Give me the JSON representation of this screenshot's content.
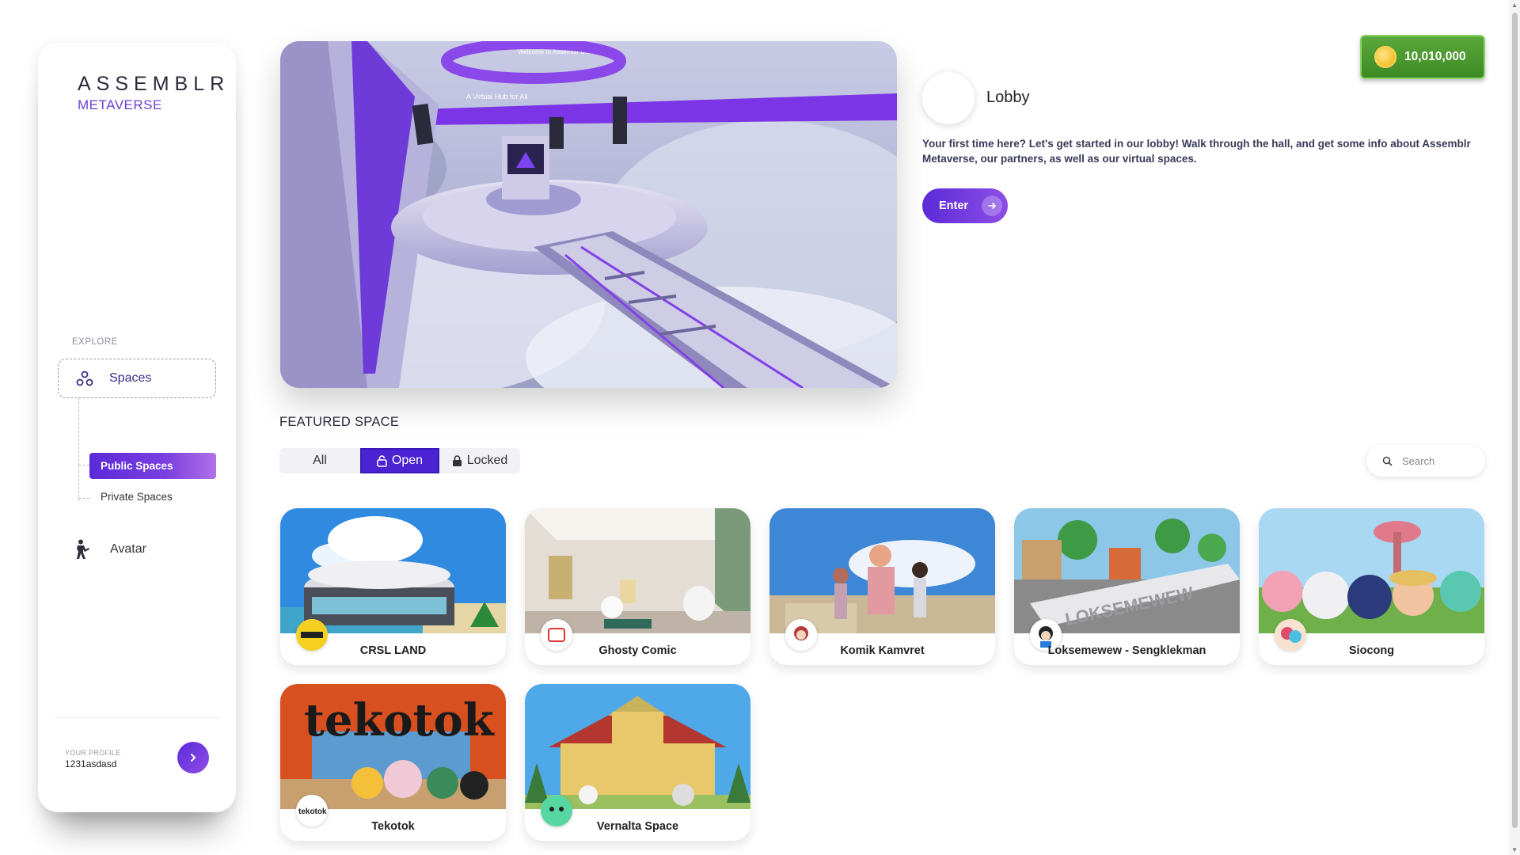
{
  "brand": {
    "name": "ASSEMBLR",
    "sub": "METAVERSE"
  },
  "sidebar": {
    "section_label": "EXPLORE",
    "spaces_label": "Spaces",
    "public_spaces_label": "Public Spaces",
    "private_spaces_label": "Private Spaces",
    "avatar_label": "Avatar",
    "profile_caption": "YOUR PROFILE",
    "profile_name": "1231asdasd"
  },
  "wallet": {
    "coins": "10,010,000"
  },
  "lobby": {
    "title": "Lobby",
    "description": "Your first time here? Let's get started in our lobby! Walk through the hall, and get some info about Assemblr Metaverse, our partners, as well as our virtual spaces.",
    "enter_label": "Enter",
    "banner_text": "A Virtual Hub for All",
    "ring_text": "Welcome to Assemblr Metaverse"
  },
  "featured": {
    "title": "FEATURED SPACE",
    "filters": {
      "all": "All",
      "open": "Open",
      "locked": "Locked"
    },
    "search_placeholder": "Search",
    "spaces": [
      {
        "name": "CRSL LAND"
      },
      {
        "name": "Ghosty Comic"
      },
      {
        "name": "Komik Kamvret"
      },
      {
        "name": "Loksemewew - Sengklekman"
      },
      {
        "name": "Siocong"
      },
      {
        "name": "Tekotok"
      },
      {
        "name": "Vernalta Space"
      }
    ],
    "card_texts": {
      "loksemewew_sign": "LOKSEMEWEW",
      "tekotok_sign": "tekotok",
      "tekotok_badge": "tekotok"
    }
  },
  "colors": {
    "accent": "#4b23d3",
    "gradient_end": "#8d4ee6",
    "coin_green": "#4a9a30"
  }
}
